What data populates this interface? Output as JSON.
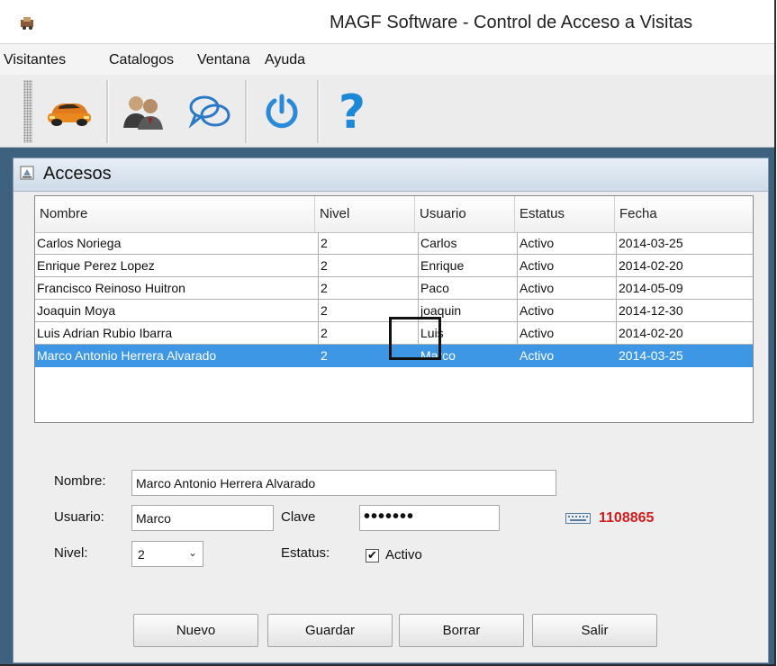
{
  "window": {
    "title": "MAGF Software - Control de Acceso a Visitas"
  },
  "menu": [
    "Visitantes",
    "Catalogos",
    "Ventana",
    "Ayuda"
  ],
  "toolbar": {
    "buttons": [
      {
        "icon": "car-icon"
      },
      {
        "icon": "users-icon"
      },
      {
        "icon": "chat-bubbles-icon"
      },
      {
        "icon": "power-icon"
      },
      {
        "icon": "help-icon"
      }
    ]
  },
  "internal_frame": {
    "title": "Accesos"
  },
  "table": {
    "columns": [
      "Nombre",
      "Nivel",
      "Usuario",
      "Estatus",
      "Fecha"
    ],
    "rows": [
      [
        "Carlos Noriega",
        "2",
        "Carlos",
        "Activo",
        "2014-03-25"
      ],
      [
        "Enrique Perez Lopez",
        "2",
        "Enrique",
        "Activo",
        "2014-02-20"
      ],
      [
        "Francisco Reinoso Huitron",
        "2",
        "Paco",
        "Activo",
        "2014-05-09"
      ],
      [
        "Joaquin Moya",
        "2",
        "joaquin",
        "Activo",
        "2014-12-30"
      ],
      [
        "Luis Adrian Rubio Ibarra",
        "2",
        "Luis",
        "Activo",
        "2014-02-20"
      ],
      [
        "Marco Antonio Herrera Alvarado",
        "2",
        "Marco",
        "Activo",
        "2014-03-25"
      ]
    ],
    "selected_row": 5,
    "selection_color": "#3d97e5"
  },
  "form": {
    "nombre_label": "Nombre:",
    "nombre_value": "Marco Antonio Herrera Alvarado",
    "usuario_label": "Usuario:",
    "usuario_value": "Marco",
    "clave_label": "Clave",
    "clave_value": "•••••••",
    "nivel_label": "Nivel:",
    "nivel_value": "2",
    "estatus_label": "Estatus:",
    "activo_label": "Activo",
    "activo_checked": true,
    "code": "1108865",
    "code_color": "#d01c1c"
  },
  "buttons": {
    "nuevo": "Nuevo",
    "guardar": "Guardar",
    "borrar": "Borrar",
    "salir": "Salir"
  }
}
